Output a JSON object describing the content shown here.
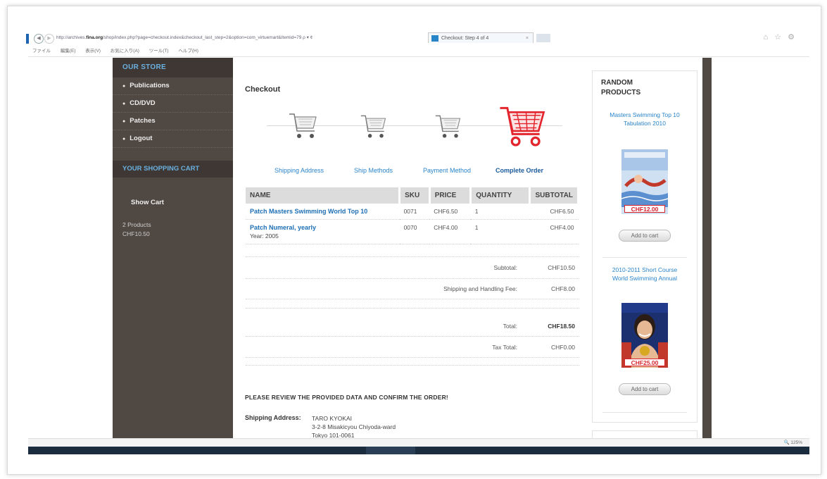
{
  "browser": {
    "url_prefix": "http://archives.",
    "url_domain": "fina.org",
    "url_rest": "/shop/index.php?page=checkout.index&checkout_last_step=2&option=com_virtuemart&Itemid=79",
    "url_controls": "ρ ▾ ¢",
    "tab_title": "Checkout: Step 4 of 4",
    "tab_close": "×",
    "menu": [
      "ファイル",
      "編集(E)",
      "表示(V)",
      "お気に入り(A)",
      "ツール(T)",
      "ヘルプ(H)"
    ],
    "icons_right": "⌂ ☆ ⚙",
    "zoom": "🔍 125%"
  },
  "sidebar": {
    "store_title": "OUR STORE",
    "items": [
      {
        "label": "Publications"
      },
      {
        "label": "CD/DVD"
      },
      {
        "label": "Patches"
      },
      {
        "label": "Logout"
      }
    ],
    "bullet": "●",
    "cart_title": "YOUR SHOPPING CART",
    "show_cart": "Show Cart",
    "cart_products": "2 Products",
    "cart_total": "CHF10.50"
  },
  "main": {
    "title": "Checkout",
    "steps": [
      {
        "label": "Shipping Address"
      },
      {
        "label": "Ship Methods"
      },
      {
        "label": "Payment Method"
      },
      {
        "label": "Complete Order"
      }
    ],
    "accent_color": "#e3262e",
    "table": {
      "headers": [
        "NAME",
        "SKU",
        "PRICE",
        "QUANTITY",
        "SUBTOTAL"
      ],
      "rows": [
        {
          "name": "Patch Masters Swimming World Top 10",
          "sku": "0071",
          "price": "CHF6.50",
          "qty": "1",
          "subtotal": "CHF6.50",
          "extra": ""
        },
        {
          "name": "Patch Numeral, yearly",
          "sku": "0070",
          "price": "CHF4.00",
          "qty": "1",
          "subtotal": "CHF4.00",
          "extra": "Year: 2005"
        }
      ]
    },
    "totals": {
      "subtotal_label": "Subtotal:",
      "subtotal": "CHF10.50",
      "shipping_label": "Shipping and Handling Fee:",
      "shipping": "CHF8.00",
      "total_label": "Total:",
      "total": "CHF18.50",
      "tax_label": "Tax Total:",
      "tax": "CHF0.00"
    },
    "review_text": "PLEASE REVIEW THE PROVIDED DATA AND CONFIRM THE ORDER!",
    "shipping_address_label": "Shipping Address:",
    "shipping_address": [
      "TARO KYOKAI",
      "3-2-8 Misakicyou Chiyoda-ward",
      "Tokyo 101-0061"
    ]
  },
  "random": {
    "title_line1": "RANDOM",
    "title_line2": "PRODUCTS",
    "products": [
      {
        "title": "Masters Swimming Top 10 Tabulation 2010",
        "price": "CHF12.00",
        "add": "Add to cart"
      },
      {
        "title": "2010-2011 Short Course World Swimming Annual",
        "price": "CHF25.00",
        "add": "Add to cart"
      }
    ]
  }
}
